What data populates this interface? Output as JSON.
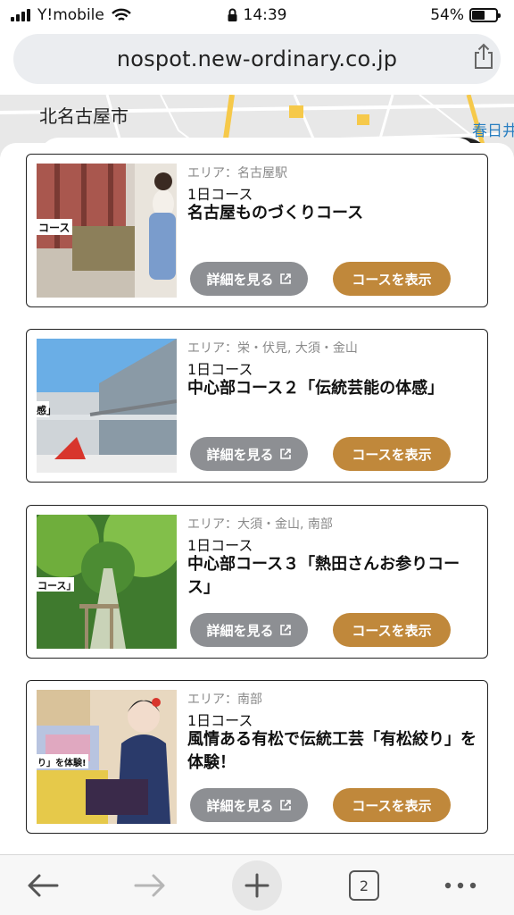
{
  "status": {
    "carrier": "Y!mobile",
    "time": "14:39",
    "battery": "54%",
    "battery_level": 0.54
  },
  "browser": {
    "url": "nospot.new-ordinary.co.jp",
    "tab_count": "2"
  },
  "map": {
    "label": "北名古屋市",
    "label_right": "春日井"
  },
  "courses": [
    {
      "area": "エリア：名古屋駅",
      "type": "1日コース",
      "title": "名古屋ものづくりコース",
      "overlay": "コース",
      "detail": "詳細を見る",
      "show": "コースを表示"
    },
    {
      "area": "エリア：栄・伏見, 大須・金山",
      "type": "1日コース",
      "title": "中心部コース２「伝統芸能の体感」",
      "overlay": "感」",
      "detail": "詳細を見る",
      "show": "コースを表示"
    },
    {
      "area": "エリア：大須・金山, 南部",
      "type": "1日コース",
      "title": "中心部コース３「熱田さんお参りコース」",
      "overlay": "コース」",
      "detail": "詳細を見る",
      "show": "コースを表示"
    },
    {
      "area": "エリア：南部",
      "type": "1日コース",
      "title": "風情ある有松で伝統工芸「有松絞り」を体験！",
      "overlay": "り」を体験!",
      "detail": "詳細を見る",
      "show": "コースを表示"
    }
  ],
  "colors": {
    "detail_button": "#8d8f93",
    "show_button": "#c0883b"
  }
}
